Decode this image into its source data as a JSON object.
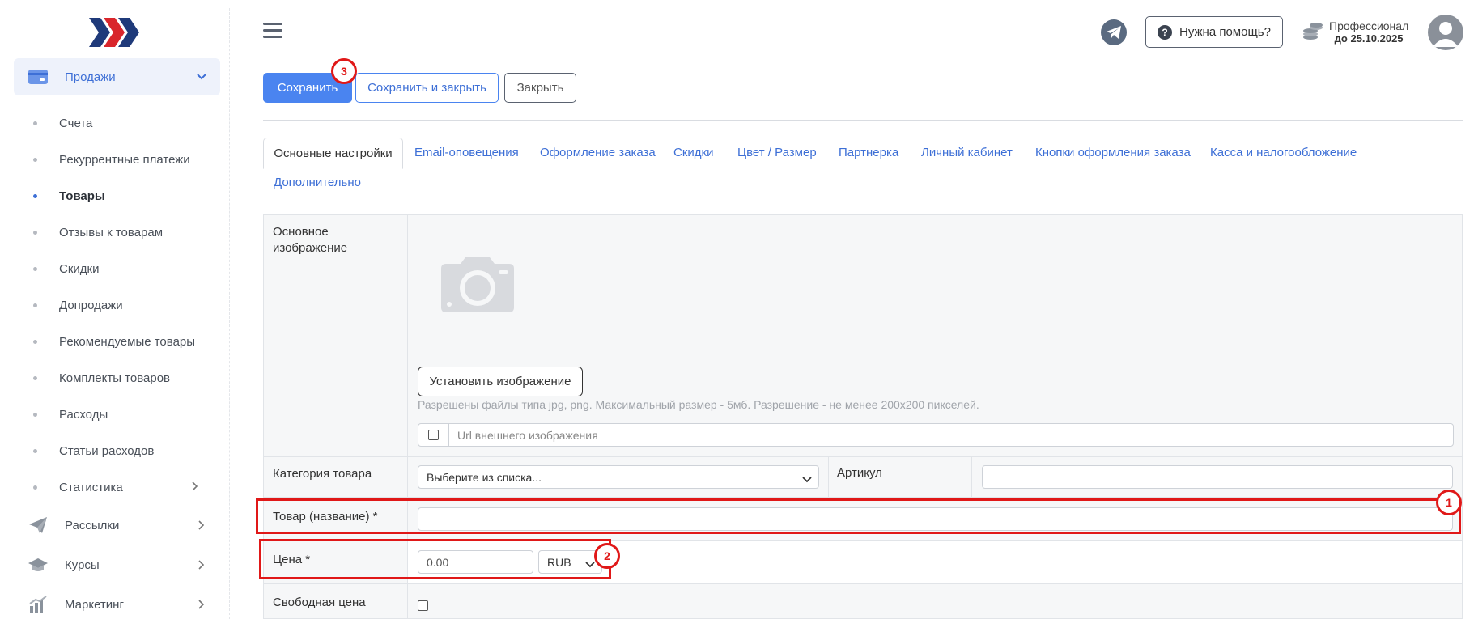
{
  "colors": {
    "accent": "#4a84f0",
    "link": "#3d6fd6",
    "annotation": "#e01818"
  },
  "sidebar": {
    "logo_icon": "chevrons-logo",
    "sales": {
      "label": "Продажи",
      "icon": "card-icon"
    },
    "sub_items": [
      {
        "label": "Счета",
        "active": false
      },
      {
        "label": "Рекуррентные платежи",
        "active": false
      },
      {
        "label": "Товары",
        "active": true
      },
      {
        "label": "Отзывы к товарам",
        "active": false
      },
      {
        "label": "Скидки",
        "active": false
      },
      {
        "label": "Допродажи",
        "active": false
      },
      {
        "label": "Рекомендуемые товары",
        "active": false
      },
      {
        "label": "Комплекты товаров",
        "active": false
      },
      {
        "label": "Расходы",
        "active": false
      },
      {
        "label": "Статьи расходов",
        "active": false
      },
      {
        "label": "Статистика",
        "active": false
      }
    ],
    "groups": [
      {
        "label": "Рассылки",
        "icon": "paper-plane-icon"
      },
      {
        "label": "Курсы",
        "icon": "graduation-cap-icon"
      },
      {
        "label": "Маркетинг",
        "icon": "bar-chart-icon"
      }
    ]
  },
  "header": {
    "help_label": "Нужна помощь?",
    "plan_name": "Профессионал",
    "plan_until": "до 25.10.2025"
  },
  "toolbar": {
    "save_label": "Сохранить",
    "save_close_label": "Сохранить и закрыть",
    "close_label": "Закрыть"
  },
  "tabs": [
    "Основные настройки",
    "Email-оповещения",
    "Оформление заказа",
    "Скидки",
    "Цвет / Размер",
    "Партнерка",
    "Личный кабинет",
    "Кнопки оформления заказа",
    "Касса и налогообложение",
    "Дополнительно"
  ],
  "form": {
    "main_image_label": "Основное изображение",
    "upload_button": "Установить изображение",
    "upload_hint": "Разрешены файлы типа jpg, png. Максимальный размер - 5мб. Разрешение - не менее 200x200 пикселей.",
    "url_placeholder": "Url внешнего изображения",
    "category_label": "Категория товара",
    "category_value": "Выберите из списка...",
    "sku_label": "Артикул",
    "sku_value": "",
    "name_label": "Товар (название) *",
    "name_value": "",
    "price_label": "Цена *",
    "price_value": "0.00",
    "currency_value": "RUB",
    "free_price_label": "Свободная цена"
  },
  "annotations": [
    "1",
    "2",
    "3"
  ]
}
